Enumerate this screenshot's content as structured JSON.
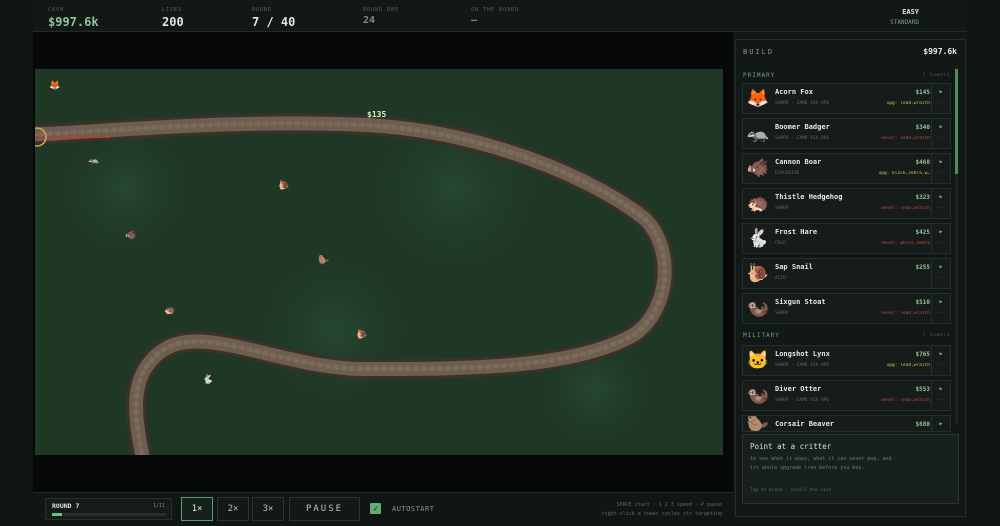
{
  "hud": {
    "cash_label": "CASH",
    "cash": "$997.6k",
    "lives_label": "LIVES",
    "lives": "200",
    "round_label": "ROUND",
    "round": "7 / 40",
    "round_rbe_label": "ROUND RBE",
    "round_rbe": "24",
    "on_board_label": "ON THE BOARD",
    "on_board": "—",
    "difficulty": "EASY",
    "mode": "STANDARD"
  },
  "board": {
    "float_text": "$135",
    "colors": {
      "grass": "#203a27",
      "path": "#6e5e4f",
      "path_edge": "#3a3128"
    },
    "critters": [
      {
        "name": "fox",
        "glyph": "🦊"
      },
      {
        "name": "badger",
        "glyph": "🦡"
      },
      {
        "name": "snail",
        "glyph": "🐌"
      },
      {
        "name": "boar",
        "glyph": "🐗"
      },
      {
        "name": "stoat",
        "glyph": "🦫"
      },
      {
        "name": "hedgehog",
        "glyph": "🦔"
      },
      {
        "name": "snail",
        "glyph": "🐌"
      },
      {
        "name": "hare",
        "glyph": "🐇"
      }
    ]
  },
  "build": {
    "title": "BUILD",
    "cash": "$997.6k",
    "sections": [
      {
        "label": "PRIMARY",
        "count": "7 towers",
        "items": [
          {
            "name": "Acorn Fox",
            "tags": "SHARP · CAMO VIA UPG",
            "price": "$145",
            "note": "upg: lead,wraith",
            "note_type": "upg",
            "glyph": "🦊"
          },
          {
            "name": "Boomer Badger",
            "tags": "SHARP · CAMO VIA UPG",
            "price": "$340",
            "note": "never: lead,wraith",
            "note_type": "never",
            "glyph": "🦡"
          },
          {
            "name": "Cannon Boar",
            "tags": "EXPLOSIVE",
            "price": "$468",
            "note": "upg: black,zebra,w…",
            "note_type": "upg",
            "glyph": "🐗"
          },
          {
            "name": "Thistle Hedgehog",
            "tags": "SHARP",
            "price": "$323",
            "note": "never: lead,wraith",
            "note_type": "never",
            "glyph": "🦔"
          },
          {
            "name": "Frost Hare",
            "tags": "COLD",
            "price": "$425",
            "note": "never: white,zebra",
            "note_type": "never",
            "glyph": "🐇"
          },
          {
            "name": "Sap Snail",
            "tags": "ACID",
            "price": "$255",
            "note": "",
            "note_type": "",
            "glyph": "🐌"
          },
          {
            "name": "Sixgun Stoat",
            "tags": "SHARP",
            "price": "$510",
            "note": "never: lead,wraith",
            "note_type": "never",
            "glyph": "🦦"
          }
        ]
      },
      {
        "label": "MILITARY",
        "count": "7 towers",
        "items": [
          {
            "name": "Longshot Lynx",
            "tags": "SHARP · CAMO VIA UPG",
            "price": "$765",
            "note": "upg: lead,wraith",
            "note_type": "upg",
            "glyph": "🐱"
          },
          {
            "name": "Diver Otter",
            "tags": "SHARP · CAMO VIA UPG",
            "price": "$553",
            "note": "never: lead,wraith",
            "note_type": "never",
            "glyph": "🦦"
          },
          {
            "name": "Corsair Beaver",
            "tags": "",
            "price": "$680",
            "note": "",
            "note_type": "",
            "glyph": "🦫"
          }
        ]
      }
    ],
    "info": {
      "title": "Point at a critter",
      "desc": "to see what it pops, what it can never pop, and its whole upgrade tree before you buy.",
      "hint": "Tap to place · scroll the list"
    }
  },
  "bottom": {
    "round_label": "ROUND 7",
    "round_count": "1/11",
    "round_progress": 0.09,
    "speeds": [
      "1×",
      "2×",
      "3×"
    ],
    "active_speed": "1×",
    "pause": "PAUSE",
    "autostart": "AUTOSTART",
    "autostart_checked": true,
    "hint_line1": "SPACE start · 1 2 3 speed · P pause",
    "hint_line2": "right-click a tower cycles its targeting"
  }
}
